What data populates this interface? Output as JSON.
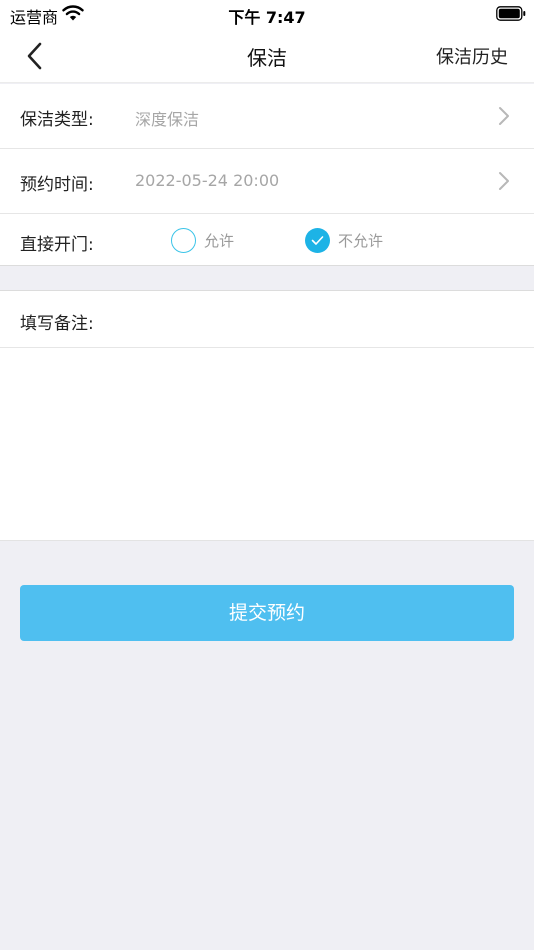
{
  "status_bar": {
    "carrier": "运营商",
    "time": "下午 7:47"
  },
  "nav": {
    "title": "保洁",
    "right_action": "保洁历史"
  },
  "form": {
    "cleaning_type": {
      "label": "保洁类型:",
      "value": "深度保洁"
    },
    "appointment_time": {
      "label": "预约时间:",
      "value": "2022-05-24 20:00"
    },
    "direct_open_door": {
      "label": "直接开门:",
      "options": [
        {
          "label": "允许",
          "selected": false
        },
        {
          "label": "不允许",
          "selected": true
        }
      ]
    },
    "remark": {
      "label": "填写备注:",
      "value": ""
    }
  },
  "submit": {
    "label": "提交预约"
  },
  "colors": {
    "accent": "#1db3e6",
    "button": "#4fbff0",
    "background": "#efeff4"
  },
  "icons": {
    "back": "chevron-left-icon",
    "row_arrow": "chevron-right-icon",
    "wifi": "wifi-icon",
    "battery": "battery-icon",
    "check": "check-icon"
  }
}
